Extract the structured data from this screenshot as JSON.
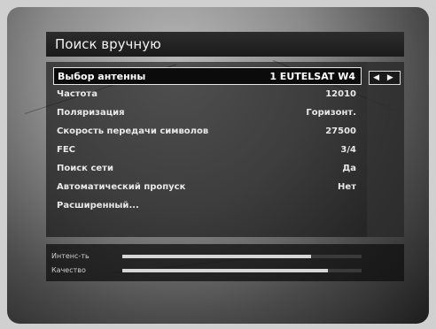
{
  "title": "Поиск вручную",
  "rows": [
    {
      "label": "Выбор антенны",
      "value": "1 EUTELSAT W4"
    },
    {
      "label": "Частота",
      "value": "12010"
    },
    {
      "label": "Поляризация",
      "value": "Горизонт."
    },
    {
      "label": "Скорость передачи символов",
      "value": "27500"
    },
    {
      "label": "FEC",
      "value": "3/4"
    },
    {
      "label": "Поиск сети",
      "value": "Да"
    },
    {
      "label": "Автоматический пропуск",
      "value": "Нет"
    },
    {
      "label": "Расширенный...",
      "value": ""
    }
  ],
  "selector_arrows": "◀ ▶",
  "meters": [
    {
      "label": "Интенс-ть",
      "level": 0.79
    },
    {
      "label": "Качество",
      "level": 0.86
    }
  ]
}
